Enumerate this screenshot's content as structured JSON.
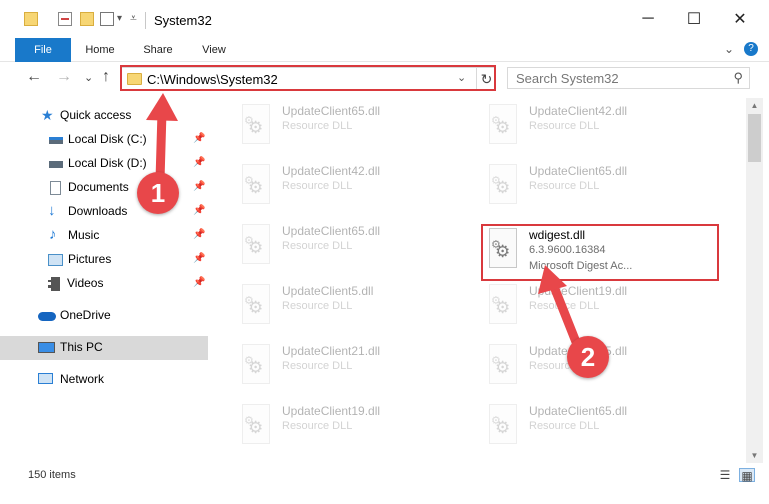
{
  "window": {
    "title": "System32",
    "qa_icons": [
      "folder-icon",
      "properties-icon",
      "new-folder-icon",
      "view-icon"
    ],
    "buttons": {
      "minimize": "─",
      "maximize": "☐",
      "close": "✕"
    }
  },
  "ribbon": {
    "tabs": [
      "File",
      "Home",
      "Share",
      "View"
    ],
    "expand_glyph": "⌄",
    "help_glyph": "?"
  },
  "navigation": {
    "back": "←",
    "forward": "→",
    "recent": "⌄",
    "up": "↑",
    "address": "C:\\Windows\\System32",
    "dropdown_glyph": "⌄",
    "refresh_glyph": "↻",
    "search_placeholder": "Search System32",
    "search_glyph": "⚲"
  },
  "sidebar": {
    "items": [
      {
        "label": "Quick access",
        "icon": "star-icon",
        "color": "#2a7fd4"
      },
      {
        "label": "Local Disk (C:)",
        "icon": "drive-icon",
        "color": "#5b6b7a",
        "pinned": true
      },
      {
        "label": "Local Disk (D:)",
        "icon": "drive-icon",
        "color": "#5b6b7a",
        "pinned": true
      },
      {
        "label": "Documents",
        "icon": "documents-icon",
        "color": "#7d8a96",
        "pinned": true
      },
      {
        "label": "Downloads",
        "icon": "download-icon",
        "color": "#1f7ad6",
        "pinned": true
      },
      {
        "label": "Music",
        "icon": "music-icon",
        "color": "#1f7ad6",
        "pinned": true
      },
      {
        "label": "Pictures",
        "icon": "pictures-icon",
        "color": "#4a90c8",
        "pinned": true
      },
      {
        "label": "Videos",
        "icon": "videos-icon",
        "color": "#555555",
        "pinned": true
      },
      {
        "label": "OneDrive",
        "icon": "cloud-icon",
        "color": "#1565c0"
      },
      {
        "label": "This PC",
        "icon": "computer-icon",
        "color": "#3a8ee6",
        "selected": true
      },
      {
        "label": "Network",
        "icon": "network-icon",
        "color": "#2a7fd4"
      }
    ],
    "pin_glyph": "📌"
  },
  "files": {
    "left": [
      {
        "name": "UpdateClient65.dll",
        "type": "Resource DLL"
      },
      {
        "name": "UpdateClient42.dll",
        "type": "Resource DLL"
      },
      {
        "name": "UpdateClient65.dll",
        "type": "Resource DLL"
      },
      {
        "name": "UpdateClient5.dll",
        "type": "Resource DLL"
      },
      {
        "name": "UpdateClient21.dll",
        "type": "Resource DLL"
      },
      {
        "name": "UpdateClient19.dll",
        "type": "Resource DLL"
      }
    ],
    "right": [
      {
        "name": "UpdateClient42.dll",
        "type": "Resource DLL"
      },
      {
        "name": "UpdateClient65.dll",
        "type": "Resource DLL"
      },
      {
        "name": "UpdateClient19.dll",
        "type": "Resource DLL"
      },
      {
        "name": "UpdateClient65.dll",
        "type": "Resource DLL"
      },
      {
        "name": "UpdateClient65.dll",
        "type": "Resource DLL"
      }
    ],
    "highlighted": {
      "name": "wdigest.dll",
      "version": "6.3.9600.16384",
      "description": "Microsoft Digest Ac..."
    }
  },
  "annotations": {
    "step1": "1",
    "step2": "2",
    "color": "#e8474a"
  },
  "status": {
    "items_count": "150 items",
    "details_view_glyph": "☰",
    "tiles_view_glyph": "▦"
  }
}
